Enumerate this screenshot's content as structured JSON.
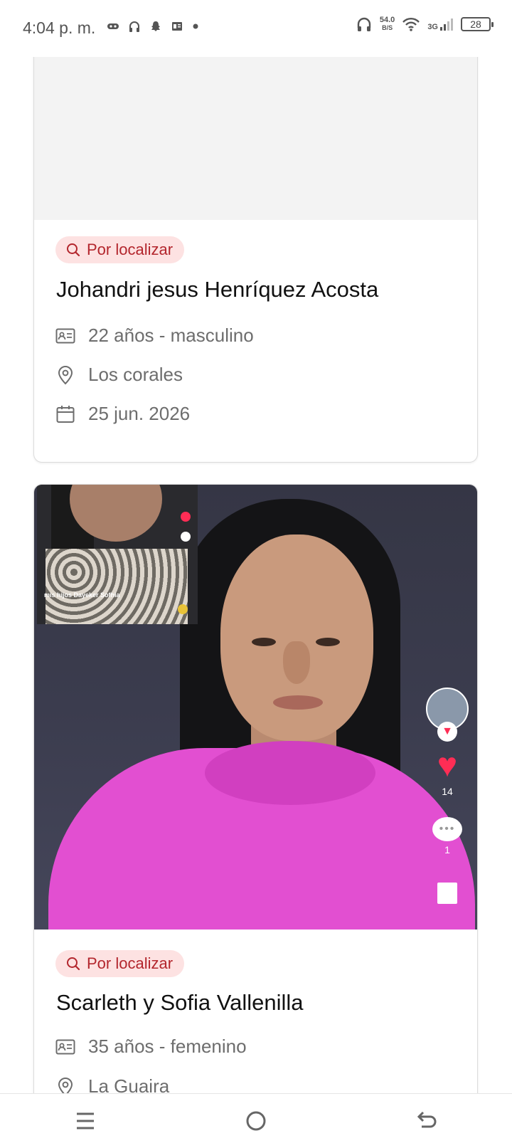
{
  "status_bar": {
    "time": "4:04 p. m.",
    "net_speed_value": "54.0",
    "net_speed_unit": "B/S",
    "network_type": "3G",
    "battery": "28"
  },
  "cards": [
    {
      "badge": "Por localizar",
      "name": "Johandri jesus Henríquez Acosta",
      "age_gender": "22 años - masculino",
      "location": "Los corales",
      "date": "25 jun. 2026"
    },
    {
      "badge": "Por localizar",
      "name": "Scarleth y Sofia Vallenilla",
      "age_gender": "35 años - femenino",
      "location": "La Guaira",
      "photo_overlay": {
        "pip_caption": "mis hijos Dayeker Sofhia",
        "likes": "14",
        "comments": "1"
      }
    }
  ],
  "icons": {
    "badge": "search-icon",
    "age_gender": "id-card-icon",
    "location": "map-pin-icon",
    "date": "calendar-icon"
  },
  "colors": {
    "badge_bg": "#fde2e2",
    "badge_text": "#b3262d",
    "muted_text": "#6d6d6d"
  }
}
